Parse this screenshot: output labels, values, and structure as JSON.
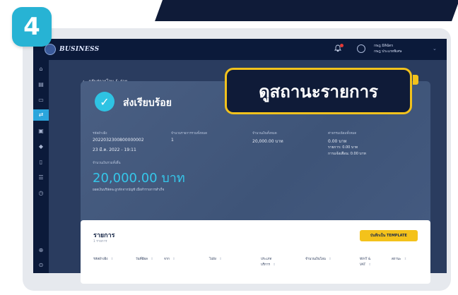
{
  "step": {
    "number": "4",
    "color": "#27b3d4"
  },
  "callout": {
    "text": "ดูสถานะรายการ",
    "border_color": "#f2c21c"
  },
  "topbar": {
    "brand": "BUSINESS",
    "user_name": "กษฎ มิติฉัตร",
    "user_role": "กษฎ ประเภทพิเศษ"
  },
  "sidebar": {
    "icons": [
      "home-icon",
      "document-icon",
      "card-icon",
      "swap-icon",
      "wallet-icon",
      "tag-icon",
      "file-icon",
      "users-icon",
      "clock-icon",
      "settings-icon",
      "logout-icon"
    ],
    "active": "swap-icon"
  },
  "back": {
    "label": "กลับสู่การโอน & จ่าย"
  },
  "status": {
    "title": "ส่งเรียบร้อย",
    "ref_label": "รหัสอ้างอิง",
    "ref_value": "2022032300800000002",
    "datetime": "23 มี.ค. 2022 - 19:11",
    "count_label": "จำนวนรายการรวมทั้งหมด",
    "count_value": "1",
    "amount_label": "จำนวนเงินทั้งหมด",
    "amount_value": "20,000.00 บาท",
    "fee_label": "ค่าธรรมเนียมทั้งหมด",
    "fee_value": "0.00 บาท",
    "fee_items": "รายการ: 0.00 บาท",
    "fee_notify": "การแจ้งเตือน: 0.00 บาท",
    "total_label": "จำนวนเงินรวมทั้งสิ้น",
    "total_value": "20,000.00 บาท",
    "note": "ยอดเงินบริษัทจะถูกหักจากบัญชี เมื่อทำรายการสำเร็จ"
  },
  "panel": {
    "title": "รายการ",
    "subtitle": "1 รายการ",
    "template_button": "บันทึกเป็น TEMPLATE",
    "columns": [
      "รหัสอ้างอิง",
      "วันที่มีผล",
      "จาก",
      "ไปยัง",
      "ประเภทบริการ",
      "จำนวนเงินโอน",
      "WHT & VAT",
      "สถานะ"
    ]
  },
  "colors": {
    "accent": "#2ec3e3",
    "navy": "#0b1a3a",
    "card": "#3e5478",
    "button": "#f4c21b"
  }
}
